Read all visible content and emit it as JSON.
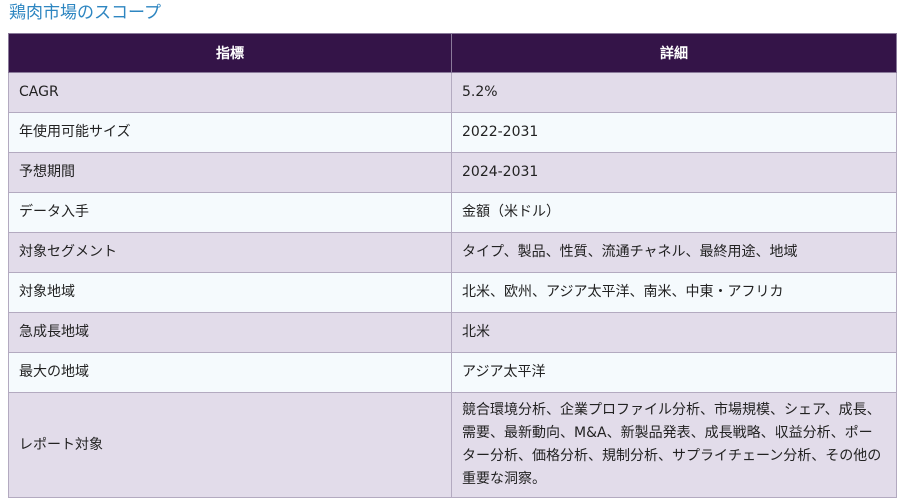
{
  "page": {
    "title": "鶏肉市場のスコープ"
  },
  "table": {
    "headers": [
      "指標",
      "詳細"
    ],
    "rows": [
      {
        "label": "CAGR",
        "value": "5.2%"
      },
      {
        "label": "年使用可能サイズ",
        "value": "2022-2031"
      },
      {
        "label": "予想期間",
        "value": "2024-2031"
      },
      {
        "label": "データ入手",
        "value": "金額（米ドル）"
      },
      {
        "label": "対象セグメント",
        "value": "タイプ、製品、性質、流通チャネル、最終用途、地域"
      },
      {
        "label": "対象地域",
        "value": "北米、欧州、アジア太平洋、南米、中東・アフリカ"
      },
      {
        "label": "急成長地域",
        "value": "北米"
      },
      {
        "label": "最大の地域",
        "value": "アジア太平洋"
      },
      {
        "label": "レポート対象",
        "value": "競合環境分析、企業プロファイル分析、市場規模、シェア、成長、需要、最新動向、M&A、新製品発表、成長戦略、収益分析、ポーター分析、価格分析、規制分析、サプライチェーン分析、その他の重要な洞察。"
      }
    ]
  },
  "colors": {
    "title": "#2e86c1",
    "header_bg": "#341448",
    "row_odd": "#e2dcea",
    "row_even": "#f5fafd"
  }
}
